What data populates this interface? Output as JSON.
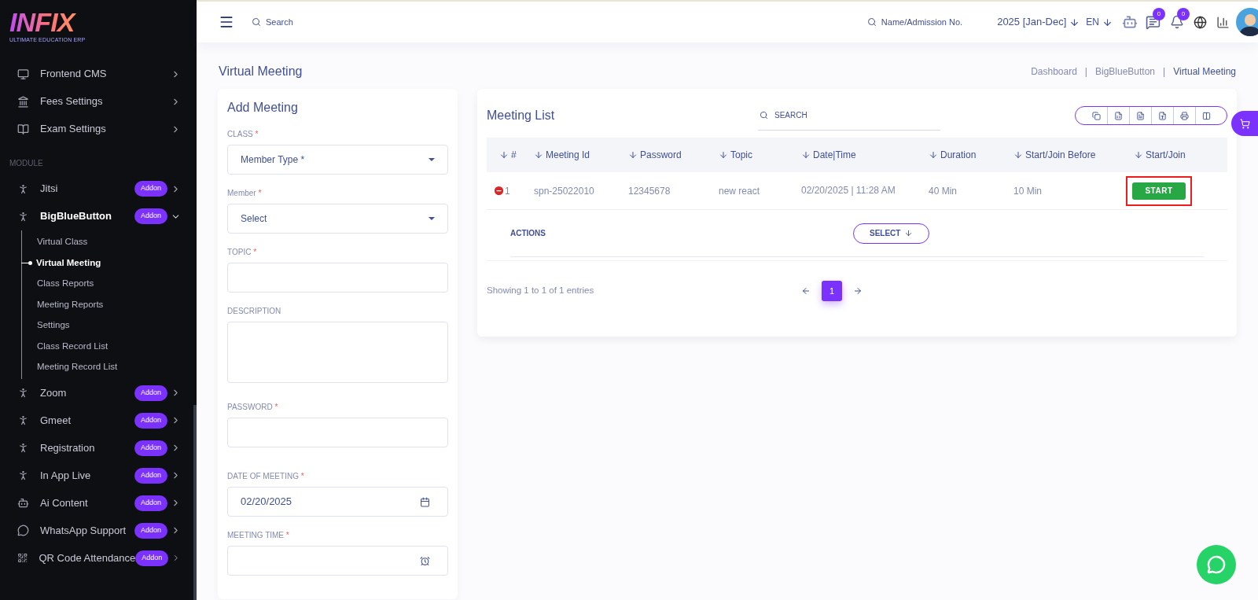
{
  "logo": {
    "title": "INFIX",
    "subtitle": "ULTIMATE EDUCATION ERP"
  },
  "sidebar": {
    "menu": [
      {
        "label": "Frontend CMS"
      },
      {
        "label": "Fees Settings"
      },
      {
        "label": "Exam Settings"
      }
    ],
    "section_title": "MODULE",
    "modules": [
      {
        "label": "Jitsi",
        "badge": "Addon",
        "expanded": false
      },
      {
        "label": "BigBlueButton",
        "badge": "Addon",
        "expanded": true,
        "children": [
          {
            "label": "Virtual Class",
            "selected": false
          },
          {
            "label": "Virtual Meeting",
            "selected": true
          },
          {
            "label": "Class Reports",
            "selected": false
          },
          {
            "label": "Meeting Reports",
            "selected": false
          },
          {
            "label": "Settings",
            "selected": false
          },
          {
            "label": "Class Record List",
            "selected": false
          },
          {
            "label": "Meeting Record List",
            "selected": false
          }
        ]
      },
      {
        "label": "Zoom",
        "badge": "Addon",
        "expanded": false
      },
      {
        "label": "Gmeet",
        "badge": "Addon",
        "expanded": false
      },
      {
        "label": "Registration",
        "badge": "Addon",
        "expanded": false
      },
      {
        "label": "In App Live",
        "badge": "Addon",
        "expanded": false
      },
      {
        "label": "Ai Content",
        "badge": "Addon",
        "expanded": false
      },
      {
        "label": "WhatsApp Support",
        "badge": "Addon",
        "expanded": false
      },
      {
        "label": "QR Code Attendance",
        "badge": "Addon",
        "expanded": false
      }
    ]
  },
  "topbar": {
    "search_placeholder": "Search",
    "student_search_placeholder": "Name/Admission No.",
    "session": "2025 [Jan-Dec]",
    "language": "EN",
    "messages_count": "0",
    "notifications_count": "0"
  },
  "page_title": "Virtual Meeting",
  "breadcrumb": [
    {
      "label": "Dashboard",
      "current": false
    },
    {
      "separator": "|",
      "label": "BigBlueButton",
      "current": false
    },
    {
      "separator": "|",
      "label": "Virtual Meeting",
      "current": true
    }
  ],
  "add_meeting": {
    "title": "Add Meeting",
    "fields": [
      {
        "kind": "select",
        "label": "CLASS",
        "required_mark": "*",
        "value": "Member Type *"
      },
      {
        "kind": "select",
        "label": "Member",
        "required_mark": "*",
        "value": "Select"
      },
      {
        "kind": "text",
        "label": "TOPIC",
        "required_mark": "*"
      },
      {
        "kind": "textarea",
        "label": "DESCRIPTION"
      },
      {
        "kind": "text",
        "label": "PASSWORD",
        "required_mark": "*"
      },
      {
        "kind": "date",
        "label": "DATE OF MEETING",
        "required_mark": "*",
        "value": "02/20/2025"
      },
      {
        "kind": "time",
        "label": "MEETING TIME",
        "required_mark": "*"
      }
    ]
  },
  "meeting_list": {
    "title": "Meeting List",
    "search_placeholder": "SEARCH",
    "columns": [
      "#",
      "Meeting Id",
      "Password",
      "Topic",
      "Date|Time",
      "Duration",
      "Start/Join Before",
      "Start/Join"
    ],
    "rows": [
      {
        "number": "1",
        "meeting_id": "spn-25022010",
        "password": "12345678",
        "topic": "new react",
        "date_time": "02/20/2025 | 11:28 AM",
        "duration": "40 Min",
        "join_before": "10 Min",
        "action": "START",
        "highlighted": true
      }
    ],
    "actions_label": "ACTIONS",
    "select_button": "SELECT",
    "footer": "Showing 1 to 1 of 1 entries",
    "pages": [
      {
        "label": "1",
        "selected": true
      }
    ]
  }
}
